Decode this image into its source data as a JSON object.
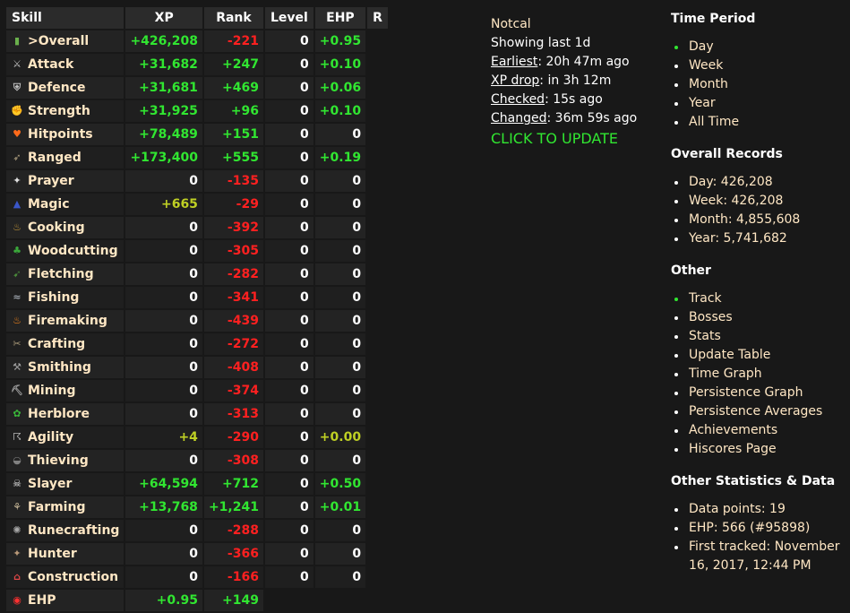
{
  "table": {
    "headers": {
      "skill": "Skill",
      "xp": "XP",
      "rank": "Rank",
      "level": "Level",
      "ehp": "EHP",
      "r": "R"
    },
    "rows": [
      {
        "icon": "overall-icon",
        "name": ">Overall",
        "xp": "+426,208",
        "rank": "-221",
        "level": "0",
        "ehp": "+0.95"
      },
      {
        "icon": "attack-icon",
        "name": "Attack",
        "xp": "+31,682",
        "rank": "+247",
        "level": "0",
        "ehp": "+0.10"
      },
      {
        "icon": "defence-icon",
        "name": "Defence",
        "xp": "+31,681",
        "rank": "+469",
        "level": "0",
        "ehp": "+0.06"
      },
      {
        "icon": "strength-icon",
        "name": "Strength",
        "xp": "+31,925",
        "rank": "+96",
        "level": "0",
        "ehp": "+0.10"
      },
      {
        "icon": "hitpoints-icon",
        "name": "Hitpoints",
        "xp": "+78,489",
        "rank": "+151",
        "level": "0",
        "ehp": "0"
      },
      {
        "icon": "ranged-icon",
        "name": "Ranged",
        "xp": "+173,400",
        "rank": "+555",
        "level": "0",
        "ehp": "+0.19"
      },
      {
        "icon": "prayer-icon",
        "name": "Prayer",
        "xp": "0",
        "rank": "-135",
        "level": "0",
        "ehp": "0"
      },
      {
        "icon": "magic-icon",
        "name": "Magic",
        "xp": "+665",
        "rank": "-29",
        "level": "0",
        "ehp": "0"
      },
      {
        "icon": "cooking-icon",
        "name": "Cooking",
        "xp": "0",
        "rank": "-392",
        "level": "0",
        "ehp": "0"
      },
      {
        "icon": "woodcutting-icon",
        "name": "Woodcutting",
        "xp": "0",
        "rank": "-305",
        "level": "0",
        "ehp": "0"
      },
      {
        "icon": "fletching-icon",
        "name": "Fletching",
        "xp": "0",
        "rank": "-282",
        "level": "0",
        "ehp": "0"
      },
      {
        "icon": "fishing-icon",
        "name": "Fishing",
        "xp": "0",
        "rank": "-341",
        "level": "0",
        "ehp": "0"
      },
      {
        "icon": "firemaking-icon",
        "name": "Firemaking",
        "xp": "0",
        "rank": "-439",
        "level": "0",
        "ehp": "0"
      },
      {
        "icon": "crafting-icon",
        "name": "Crafting",
        "xp": "0",
        "rank": "-272",
        "level": "0",
        "ehp": "0"
      },
      {
        "icon": "smithing-icon",
        "name": "Smithing",
        "xp": "0",
        "rank": "-408",
        "level": "0",
        "ehp": "0"
      },
      {
        "icon": "mining-icon",
        "name": "Mining",
        "xp": "0",
        "rank": "-374",
        "level": "0",
        "ehp": "0"
      },
      {
        "icon": "herblore-icon",
        "name": "Herblore",
        "xp": "0",
        "rank": "-313",
        "level": "0",
        "ehp": "0"
      },
      {
        "icon": "agility-icon",
        "name": "Agility",
        "xp": "+4",
        "rank": "-290",
        "level": "0",
        "ehp": "+0.00"
      },
      {
        "icon": "thieving-icon",
        "name": "Thieving",
        "xp": "0",
        "rank": "-308",
        "level": "0",
        "ehp": "0"
      },
      {
        "icon": "slayer-icon",
        "name": "Slayer",
        "xp": "+64,594",
        "rank": "+712",
        "level": "0",
        "ehp": "+0.50"
      },
      {
        "icon": "farming-icon",
        "name": "Farming",
        "xp": "+13,768",
        "rank": "+1,241",
        "level": "0",
        "ehp": "+0.01"
      },
      {
        "icon": "runecrafting-icon",
        "name": "Runecrafting",
        "xp": "0",
        "rank": "-288",
        "level": "0",
        "ehp": "0"
      },
      {
        "icon": "hunter-icon",
        "name": "Hunter",
        "xp": "0",
        "rank": "-366",
        "level": "0",
        "ehp": "0"
      },
      {
        "icon": "construction-icon",
        "name": "Construction",
        "xp": "0",
        "rank": "-166",
        "level": "0",
        "ehp": "0"
      },
      {
        "icon": "ehp-icon",
        "name": "EHP",
        "xp": "+0.95",
        "rank": "+149",
        "level": "",
        "ehp": ""
      }
    ]
  },
  "info": {
    "player": "Notcal",
    "showing": "Showing last 1d",
    "earliest_label": "Earliest",
    "earliest_value": ": 20h 47m ago",
    "xpdrop_label": "XP drop",
    "xpdrop_value": ": in 3h 12m",
    "checked_label": "Checked",
    "checked_value": ": 15s ago",
    "changed_label": "Changed",
    "changed_value": ": 36m 59s ago",
    "update": "CLICK TO UPDATE"
  },
  "panel": {
    "time_period_title": "Time Period",
    "time_period": [
      "Day",
      "Week",
      "Month",
      "Year",
      "All Time"
    ],
    "records_title": "Overall Records",
    "records": [
      "Day: 426,208",
      "Week: 426,208",
      "Month: 4,855,608",
      "Year: 5,741,682"
    ],
    "other_title": "Other",
    "other": [
      "Track",
      "Bosses",
      "Stats",
      "Update Table",
      "Time Graph",
      "Persistence Graph",
      "Persistence Averages",
      "Achievements",
      "Hiscores Page"
    ],
    "stats_title": "Other Statistics & Data",
    "stats": [
      "Data points: 19",
      "EHP: 566 (#95898)",
      "First tracked: November 16, 2017, 12:44 PM"
    ]
  },
  "colors": {
    "positive": "#31e631",
    "negative": "#ff2020",
    "small_positive": "#bfd024",
    "skill_text": "#ffe7c4",
    "background": "#181818"
  }
}
